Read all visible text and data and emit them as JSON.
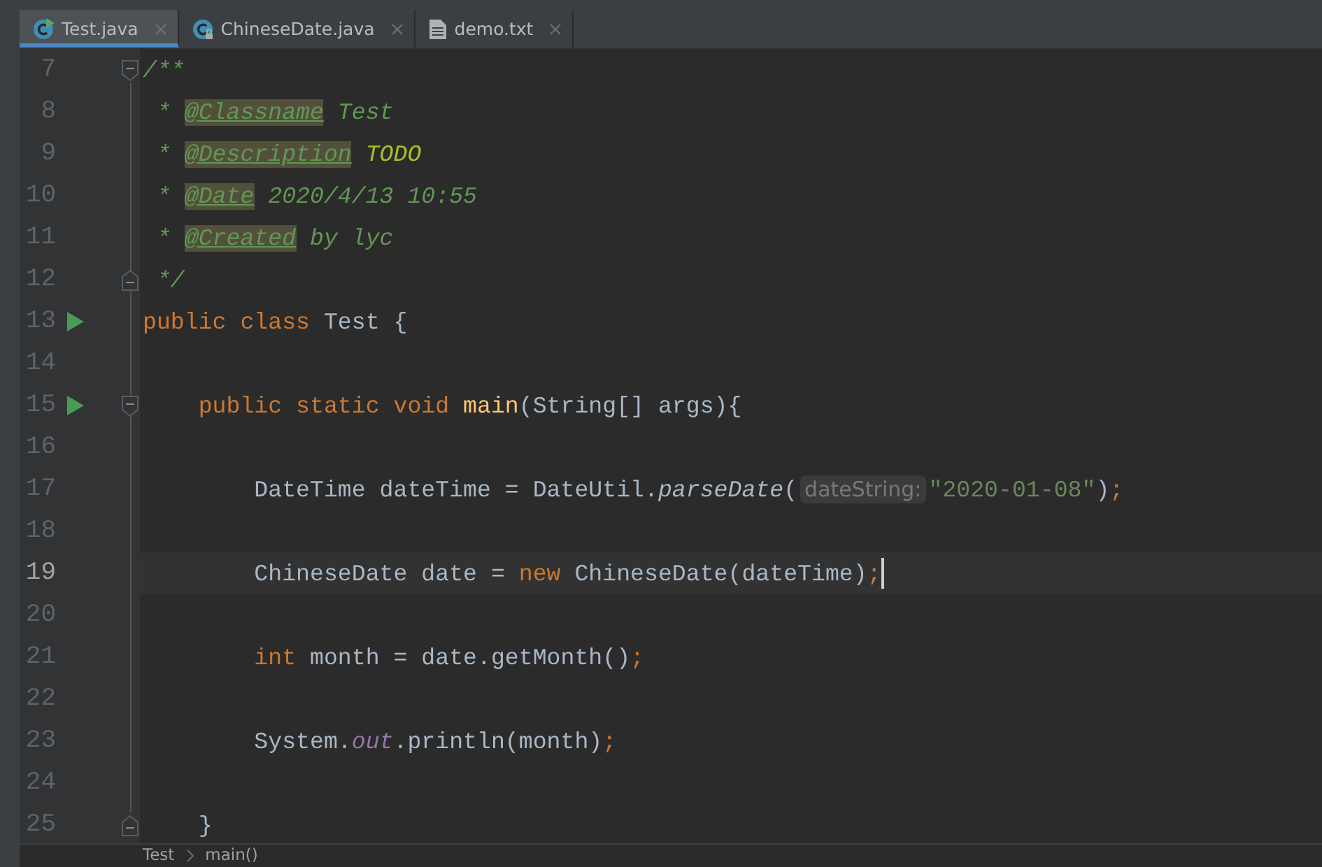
{
  "tabs": [
    {
      "label": "Test.java",
      "kind": "class-run",
      "selected": true
    },
    {
      "label": "ChineseDate.java",
      "kind": "class-locked",
      "selected": false
    },
    {
      "label": "demo.txt",
      "kind": "text",
      "selected": false
    }
  ],
  "lines": [
    {
      "number": "7",
      "run": false,
      "fold_open": true,
      "fold_close": false,
      "current": false,
      "tokens": [
        {
          "kind": "comment",
          "text": "/**"
        }
      ]
    },
    {
      "number": "8",
      "run": false,
      "fold_open": false,
      "fold_close": false,
      "current": false,
      "tokens": [
        {
          "kind": "comment",
          "text": " * "
        },
        {
          "kind": "tag",
          "text": "@Classname"
        },
        {
          "kind": "comment",
          "text": " Test"
        }
      ]
    },
    {
      "number": "9",
      "run": false,
      "fold_open": false,
      "fold_close": false,
      "current": false,
      "tokens": [
        {
          "kind": "comment",
          "text": " * "
        },
        {
          "kind": "tag",
          "text": "@Description"
        },
        {
          "kind": "todo",
          "text": " TODO"
        }
      ]
    },
    {
      "number": "10",
      "run": false,
      "fold_open": false,
      "fold_close": false,
      "current": false,
      "tokens": [
        {
          "kind": "comment",
          "text": " * "
        },
        {
          "kind": "tag",
          "text": "@Date"
        },
        {
          "kind": "comment",
          "text": " 2020/4/13 10:55"
        }
      ]
    },
    {
      "number": "11",
      "run": false,
      "fold_open": false,
      "fold_close": false,
      "current": false,
      "tokens": [
        {
          "kind": "comment",
          "text": " * "
        },
        {
          "kind": "tag",
          "text": "@Created"
        },
        {
          "kind": "comment",
          "text": " by lyc"
        }
      ]
    },
    {
      "number": "12",
      "run": false,
      "fold_open": false,
      "fold_close": true,
      "current": false,
      "tokens": [
        {
          "kind": "comment",
          "text": " */"
        }
      ]
    },
    {
      "number": "13",
      "run": true,
      "fold_open": false,
      "fold_close": false,
      "current": false,
      "tokens": [
        {
          "kind": "keyword",
          "text": "public class "
        },
        {
          "kind": "plain",
          "text": "Test {"
        }
      ]
    },
    {
      "number": "14",
      "run": false,
      "fold_open": false,
      "fold_close": false,
      "current": false
    },
    {
      "number": "15",
      "run": true,
      "fold_open": true,
      "fold_close": false,
      "current": false,
      "tokens": [
        {
          "kind": "keyword",
          "text": "    public static void "
        },
        {
          "kind": "declaration",
          "text": "main"
        },
        {
          "kind": "plain",
          "text": "(String[] args){"
        }
      ]
    },
    {
      "number": "16",
      "run": false,
      "fold_open": false,
      "fold_close": false,
      "current": false
    },
    {
      "number": "17",
      "run": false,
      "fold_open": false,
      "fold_close": false,
      "current": false,
      "tokens": [
        {
          "kind": "plain",
          "text": "        DateTime dateTime = DateUtil."
        },
        {
          "kind": "static-call",
          "text": "parseDate"
        },
        {
          "kind": "plain",
          "text": "("
        },
        {
          "kind": "hint",
          "text": "dateString:"
        },
        {
          "kind": "string",
          "text": "\"2020-01-08\""
        },
        {
          "kind": "plain",
          "text": ")"
        },
        {
          "kind": "punct",
          "text": ";"
        }
      ]
    },
    {
      "number": "18",
      "run": false,
      "fold_open": false,
      "fold_close": false,
      "current": false
    },
    {
      "number": "19",
      "run": false,
      "fold_open": false,
      "fold_close": false,
      "current": true,
      "tokens": [
        {
          "kind": "plain",
          "text": "        ChineseDate date = "
        },
        {
          "kind": "keyword",
          "text": "new "
        },
        {
          "kind": "plain",
          "text": "ChineseDate(dateTime)"
        },
        {
          "kind": "punct",
          "text": ";"
        }
      ]
    },
    {
      "number": "20",
      "run": false,
      "fold_open": false,
      "fold_close": false,
      "current": false
    },
    {
      "number": "21",
      "run": false,
      "fold_open": false,
      "fold_close": false,
      "current": false,
      "tokens": [
        {
          "kind": "keyword",
          "text": "        int "
        },
        {
          "kind": "plain",
          "text": "month = date.getMonth()"
        },
        {
          "kind": "punct",
          "text": ";"
        }
      ]
    },
    {
      "number": "22",
      "run": false,
      "fold_open": false,
      "fold_close": false,
      "current": false
    },
    {
      "number": "23",
      "run": false,
      "fold_open": false,
      "fold_close": false,
      "current": false,
      "tokens": [
        {
          "kind": "plain",
          "text": "        System."
        },
        {
          "kind": "static-field",
          "text": "out"
        },
        {
          "kind": "plain",
          "text": ".println(month)"
        },
        {
          "kind": "punct",
          "text": ";"
        }
      ]
    },
    {
      "number": "24",
      "run": false,
      "fold_open": false,
      "fold_close": false,
      "current": false
    },
    {
      "number": "25",
      "run": false,
      "fold_open": false,
      "fold_close": true,
      "current": false,
      "tokens": [
        {
          "kind": "plain",
          "text": "    }"
        }
      ]
    }
  ],
  "breadcrumb": [
    "Test",
    "main()"
  ]
}
